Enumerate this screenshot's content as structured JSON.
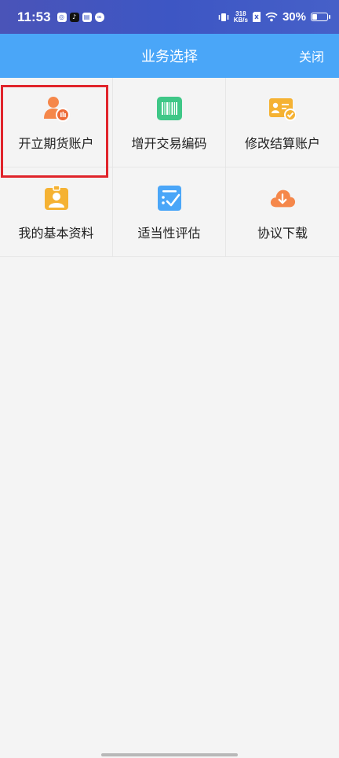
{
  "status_bar": {
    "time": "11:53",
    "net_speed_value": "318",
    "net_speed_unit": "KB/s",
    "battery_percent": "30%",
    "battery_level": 0.3
  },
  "header": {
    "title": "业务选择",
    "close_label": "关闭"
  },
  "menu": {
    "items": [
      {
        "label": "开立期货账户",
        "icon": "user-badge-icon",
        "color": "#f5874a"
      },
      {
        "label": "增开交易编码",
        "icon": "barcode-icon",
        "color": "#3fc787"
      },
      {
        "label": "修改结算账户",
        "icon": "card-check-icon",
        "color": "#f5b233"
      },
      {
        "label": "我的基本资料",
        "icon": "profile-badge-icon",
        "color": "#f5b233"
      },
      {
        "label": "适当性评估",
        "icon": "checklist-icon",
        "color": "#4aa6f8"
      },
      {
        "label": "协议下载",
        "icon": "cloud-download-icon",
        "color": "#f5874a"
      }
    ]
  },
  "colors": {
    "header_bg": "#4aa6f8",
    "highlight": "#e0242b"
  }
}
